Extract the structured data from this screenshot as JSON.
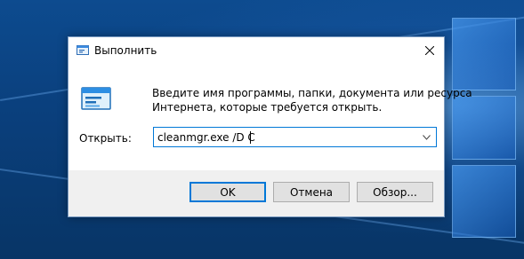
{
  "window": {
    "title": "Выполнить",
    "description_line1": "Введите имя программы, папки, документа или ресурса",
    "description_line2": "Интернета, которые требуется открыть.",
    "open_label": "Открыть:",
    "command_value": "cleanmgr.exe /D C",
    "ok_label": "OK",
    "cancel_label": "Отмена",
    "browse_label": "Обзор..."
  },
  "icons": {
    "title_icon": "run-icon",
    "body_icon": "run-icon",
    "close_icon": "close-icon",
    "dropdown_icon": "chevron-down-icon"
  },
  "colors": {
    "accent": "#0078d7",
    "footer_bg": "#f0f0f0",
    "button_bg": "#e1e1e1",
    "desktop_bg": "#0a3f7c"
  }
}
